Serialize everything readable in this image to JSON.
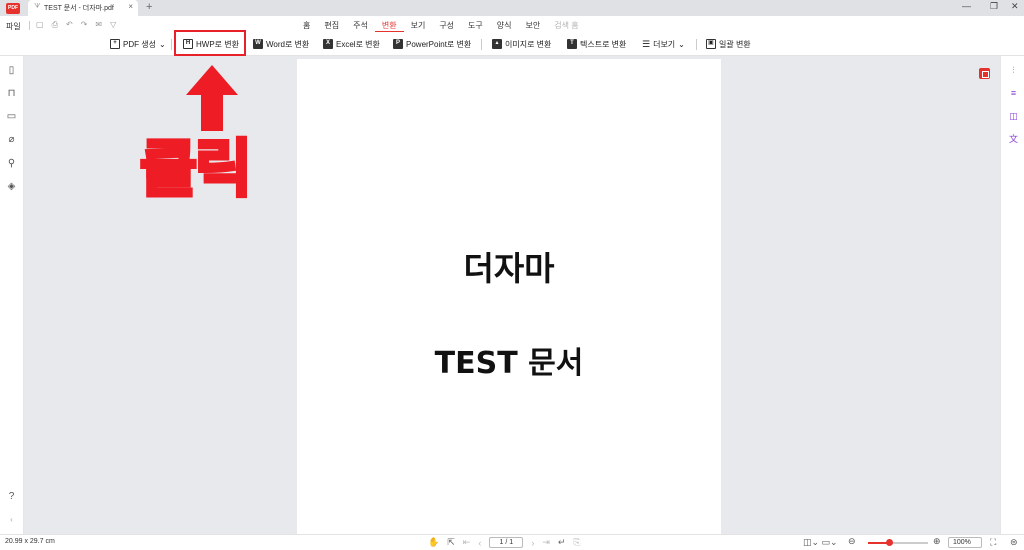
{
  "titlebar": {
    "app_logo": "PDF",
    "tab_title": "TEST 문서 - 더자마.pdf",
    "tab_close": "×",
    "new_tab": "+",
    "minimize": "—",
    "restore": "❐",
    "close": "✕"
  },
  "file_menu": "파일",
  "menu_tabs": [
    "홈",
    "편집",
    "주석",
    "변환",
    "보기",
    "구성",
    "도구",
    "양식",
    "보안",
    "검색 홈"
  ],
  "active_tab": "변환",
  "ribbon": {
    "create_pdf": "PDF 생성",
    "to_hwp": "HWP로 변환",
    "to_word": "Word로 변환",
    "to_excel": "Excel로 변환",
    "to_ppt": "PowerPoint로 변환",
    "to_image": "이미지로 변환",
    "to_text": "텍스트로 변환",
    "more": "더보기",
    "batch": "일괄 변환"
  },
  "annotation": {
    "click_text": "클릭",
    "highlight_color": "#e8202a"
  },
  "document": {
    "title": "더자마",
    "subtitle": "TEST 문서"
  },
  "statusbar": {
    "page_size": "20.99 x 29.7 cm",
    "page_indicator": "1 / 1",
    "zoom": "100%",
    "zoom_fraction": 0.35
  },
  "colors": {
    "accent": "#e5322d",
    "canvas_bg": "#e8e9ed"
  }
}
